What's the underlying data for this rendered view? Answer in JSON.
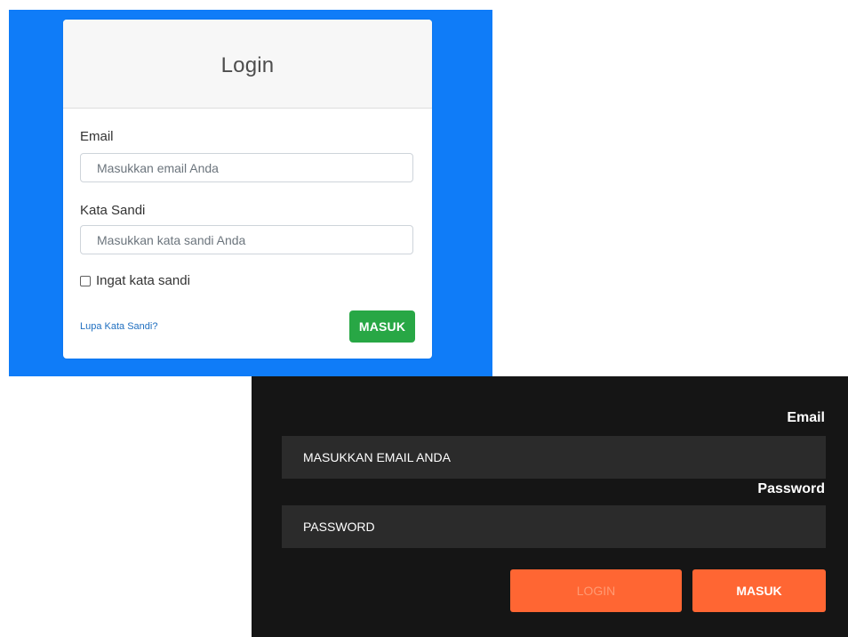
{
  "light_form": {
    "title": "Login",
    "email_label": "Email",
    "email_placeholder": "Masukkan email Anda",
    "password_label": "Kata Sandi",
    "password_placeholder": "Masukkan kata sandi Anda",
    "remember_label": "Ingat kata sandi",
    "remember_checked": false,
    "forgot_link": "Lupa Kata Sandi?",
    "submit_label": "MASUK",
    "colors": {
      "background": "#0f7cf8",
      "submit": "#28a745",
      "link": "#1f6fc0"
    }
  },
  "dark_form": {
    "email_label": "Email",
    "email_placeholder": "MASUKKAN EMAIL ANDA",
    "password_label": "Password",
    "password_placeholder": "PASSWORD",
    "login_label": "LOGIN",
    "submit_label": "MASUK",
    "colors": {
      "background": "#151515",
      "input": "#2b2b2b",
      "button": "#ff6633"
    }
  }
}
